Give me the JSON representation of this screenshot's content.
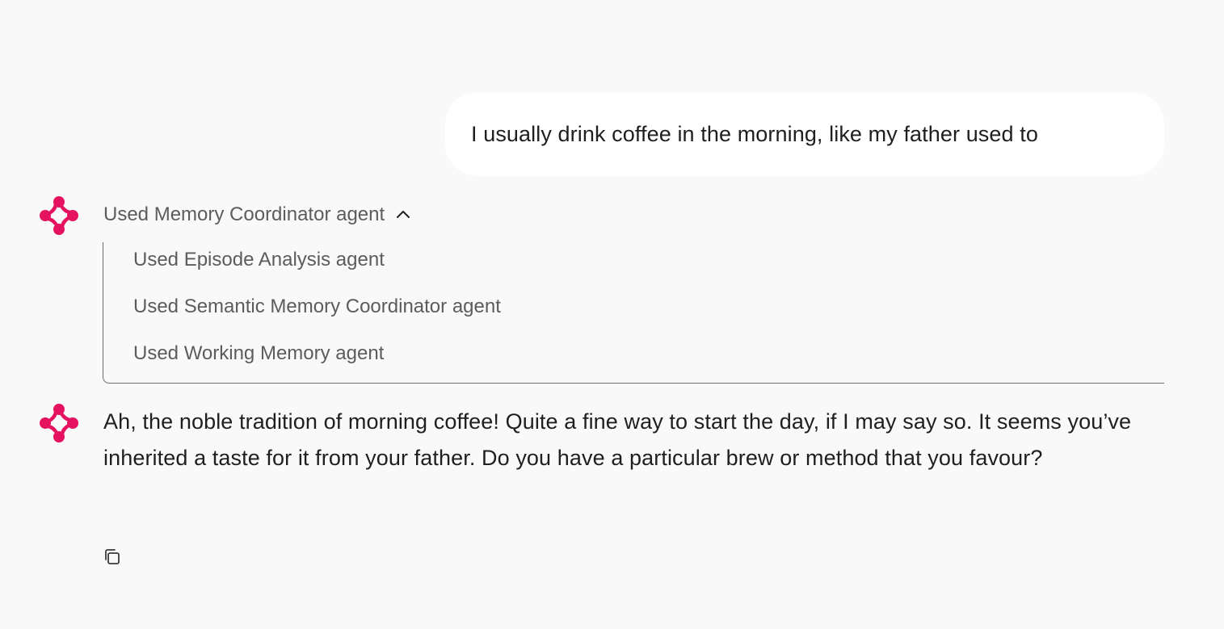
{
  "conversation": {
    "user_message": "I usually drink coffee in the morning, like my father used to",
    "tool_group": {
      "header_label": "Used Memory Coordinator agent",
      "expanded": true,
      "items": [
        {
          "label": "Used Episode Analysis agent"
        },
        {
          "label": "Used Semantic Memory Coordinator agent"
        },
        {
          "label": "Used Working Memory agent"
        }
      ]
    },
    "assistant_reply": "Ah, the noble tradition of morning coffee! Quite a fine way to start the day, if I may say so. It seems you’ve inherited a taste for it from your father. Do you have a particular brew or method that you favour?"
  },
  "icons": {
    "avatar": "assistant-logo-icon",
    "toggle": "chevron-up-icon",
    "copy": "copy-icon"
  },
  "colors": {
    "background": "#f9f9f9",
    "bubble": "#ffffff",
    "brand": "#e5135f",
    "muted_text": "#5c5c5c",
    "text": "#1f1f1f"
  }
}
